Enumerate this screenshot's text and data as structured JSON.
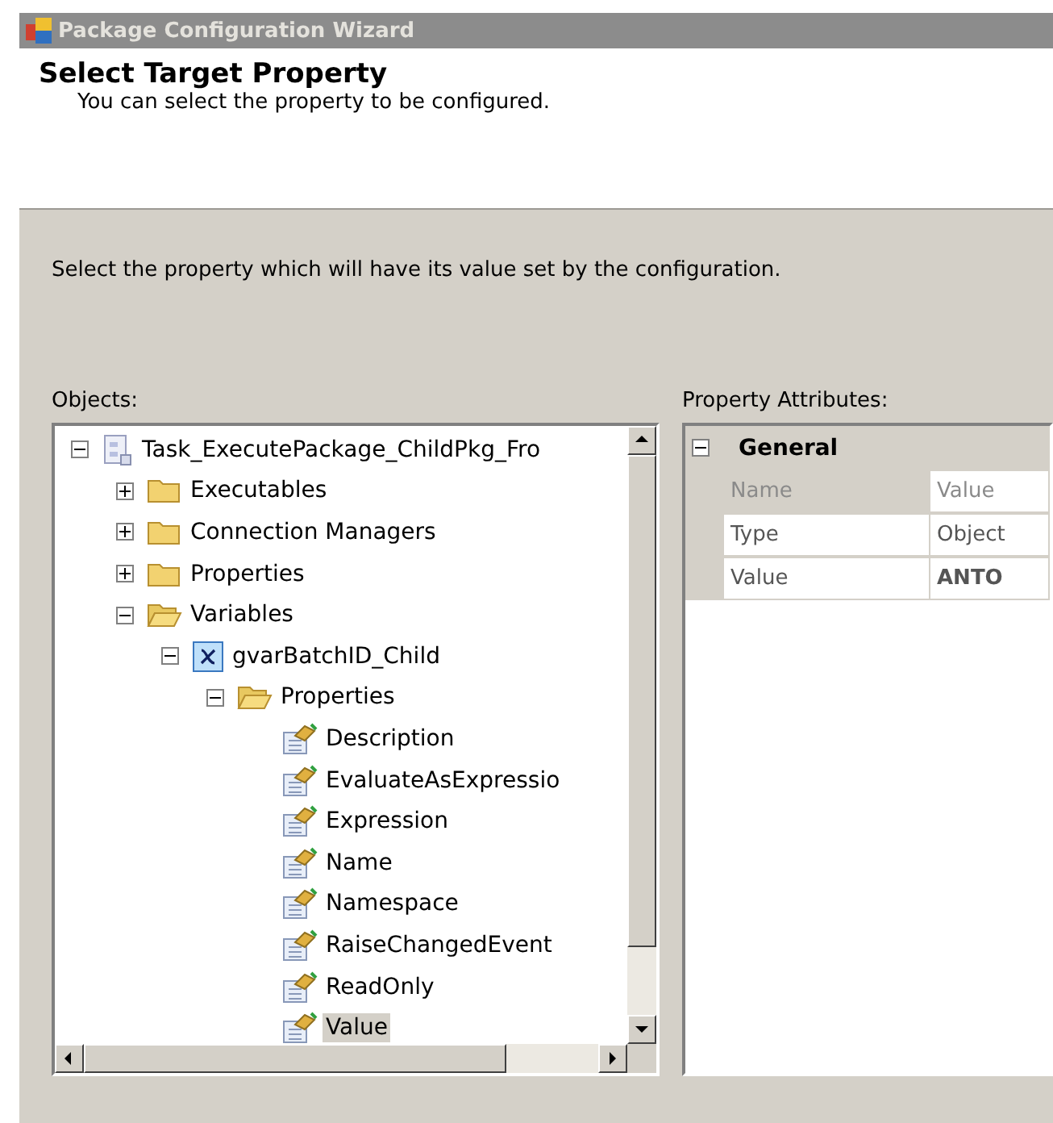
{
  "window": {
    "title": "Package Configuration Wizard"
  },
  "header": {
    "title": "Select Target Property",
    "subtitle": "You can select the property to be configured."
  },
  "instruction": "Select the property which will have its value set by the configuration.",
  "objects": {
    "label": "Objects:",
    "tree": [
      {
        "label": "Task_ExecutePackage_ChildPkg_Fro",
        "kind": "package",
        "expanded": true,
        "selected": false,
        "children": [
          {
            "label": "Executables",
            "kind": "folder",
            "expanded": false,
            "selected": false
          },
          {
            "label": "Connection Managers",
            "kind": "folder",
            "expanded": false,
            "selected": false
          },
          {
            "label": "Properties",
            "kind": "folder",
            "expanded": false,
            "selected": false
          },
          {
            "label": "Variables",
            "kind": "folder",
            "expanded": true,
            "selected": false,
            "children": [
              {
                "label": "gvarBatchID_Child",
                "kind": "variable",
                "expanded": true,
                "selected": false,
                "children": [
                  {
                    "label": "Properties",
                    "kind": "folder",
                    "expanded": true,
                    "selected": false,
                    "children": [
                      {
                        "label": "Description",
                        "kind": "property",
                        "selected": false
                      },
                      {
                        "label": "EvaluateAsExpressio",
                        "kind": "property",
                        "selected": false
                      },
                      {
                        "label": "Expression",
                        "kind": "property",
                        "selected": false
                      },
                      {
                        "label": "Name",
                        "kind": "property",
                        "selected": false
                      },
                      {
                        "label": "Namespace",
                        "kind": "property",
                        "selected": false
                      },
                      {
                        "label": "RaiseChangedEvent",
                        "kind": "property",
                        "selected": false
                      },
                      {
                        "label": "ReadOnly",
                        "kind": "property",
                        "selected": false
                      },
                      {
                        "label": "Value",
                        "kind": "property",
                        "selected": true
                      }
                    ]
                  }
                ]
              }
            ]
          }
        ]
      }
    ]
  },
  "attributes": {
    "label": "Property Attributes:",
    "category": "General",
    "expanded": true,
    "rows": [
      {
        "name": "Name",
        "value": "Value",
        "header": true
      },
      {
        "name": "Type",
        "value": "Object",
        "header": false
      },
      {
        "name": "Value",
        "value": "ANTO",
        "header": false,
        "bold": true
      }
    ]
  }
}
